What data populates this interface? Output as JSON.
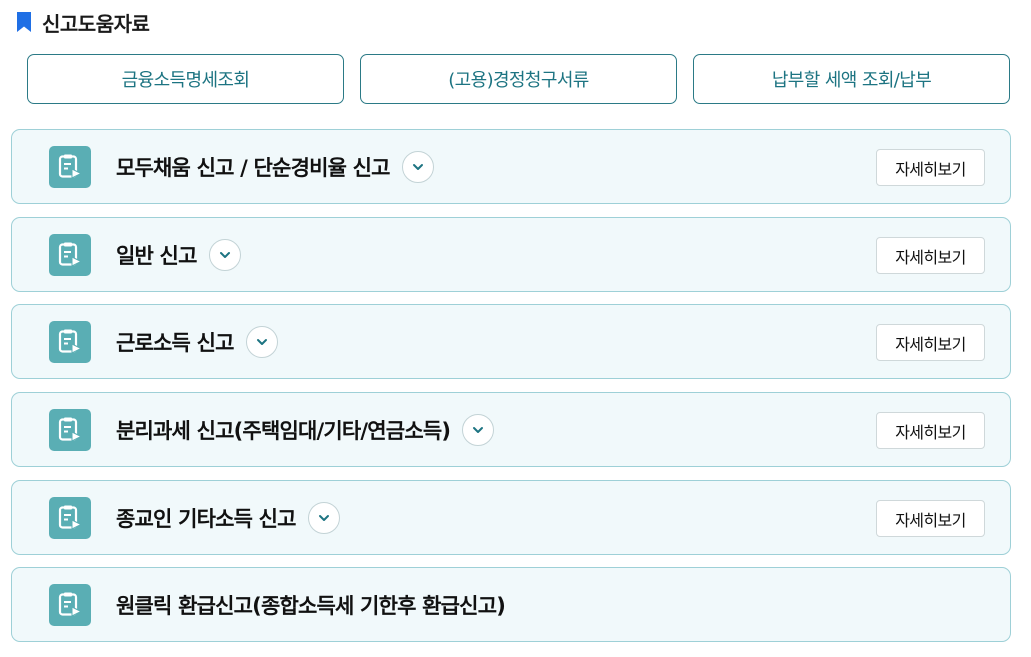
{
  "header": {
    "title": "신고도움자료",
    "icon": "bookmark-icon",
    "icon_color": "#1f6fe5"
  },
  "quick_links": [
    {
      "label": "금융소득명세조회"
    },
    {
      "label": "(고용)경정청구서류"
    },
    {
      "label": "납부할 세액 조회/납부"
    }
  ],
  "cards": [
    {
      "title": "모두채움 신고 / 단순경비율 신고",
      "has_toggle": true,
      "detail_label": "자세히보기"
    },
    {
      "title": "일반 신고",
      "has_toggle": true,
      "detail_label": "자세히보기"
    },
    {
      "title": "근로소득 신고",
      "has_toggle": true,
      "detail_label": "자세히보기"
    },
    {
      "title": "분리과세 신고(주택임대/기타/연금소득)",
      "has_toggle": true,
      "detail_label": "자세히보기"
    },
    {
      "title": "종교인 기타소득 신고",
      "has_toggle": true,
      "detail_label": "자세히보기"
    },
    {
      "title": "원클릭 환급신고(종합소득세 기한후 환급신고)",
      "has_toggle": false,
      "detail_label": ""
    }
  ],
  "colors": {
    "accent": "#1d7482",
    "card_bg": "#f1f9fb",
    "card_border": "#9ed0d7",
    "icon_bg": "#5aaeb4"
  },
  "icons": {
    "card": "document-play-icon",
    "toggle": "chevron-down-icon"
  }
}
